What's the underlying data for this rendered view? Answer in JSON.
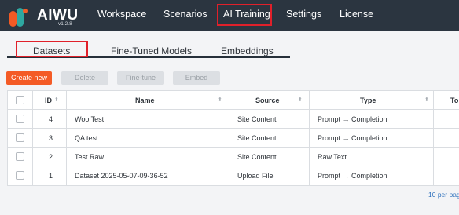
{
  "app": {
    "logo_text": "AIWU",
    "version": "v1.2.8"
  },
  "nav": {
    "items": [
      {
        "label": "Workspace"
      },
      {
        "label": "Scenarios"
      },
      {
        "label": "AI Training",
        "active": true
      },
      {
        "label": "Settings"
      },
      {
        "label": "License"
      }
    ]
  },
  "tabs": {
    "items": [
      {
        "label": "Datasets",
        "active": true
      },
      {
        "label": "Fine-Tuned Models"
      },
      {
        "label": "Embeddings"
      }
    ]
  },
  "toolbar": {
    "create_label": "Create new",
    "delete_label": "Delete",
    "finetune_label": "Fine-tune",
    "embed_label": "Embed"
  },
  "table": {
    "headers": {
      "id": "ID",
      "name": "Name",
      "source": "Source",
      "type": "Type",
      "extra": "To"
    },
    "rows": [
      {
        "id": "4",
        "name": "Woo Test",
        "source": "Site Content",
        "type": "Prompt → Completion"
      },
      {
        "id": "3",
        "name": "QA test",
        "source": "Site Content",
        "type": "Prompt → Completion"
      },
      {
        "id": "2",
        "name": "Test Raw",
        "source": "Site Content",
        "type": "Raw Text"
      },
      {
        "id": "1",
        "name": "Dataset 2025-05-07-09-36-52",
        "source": "Upload File",
        "type": "Prompt → Completion"
      }
    ]
  },
  "pagination": {
    "per_page_label": "10 per pag"
  },
  "colors": {
    "topbar": "#2b3540",
    "accent": "#f45b26",
    "highlight_box": "#e0202a",
    "link": "#2a6ebb"
  },
  "icons": {
    "logo": "aiwu-logo-icon",
    "sort": "sort-icon",
    "checkbox": "checkbox-icon"
  }
}
